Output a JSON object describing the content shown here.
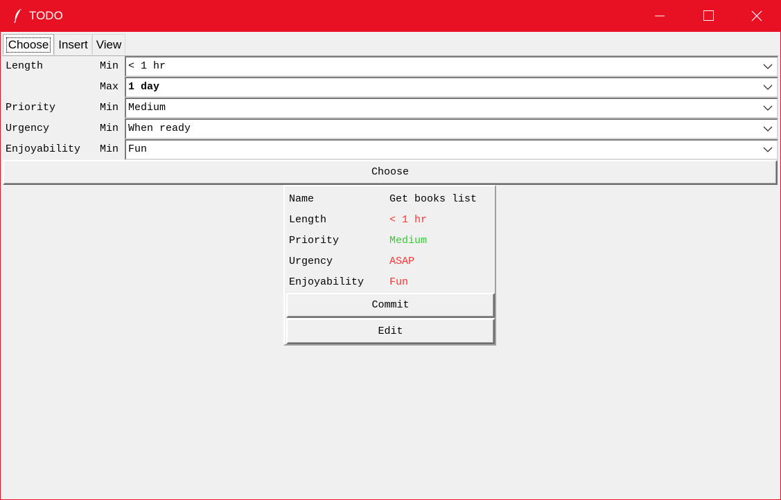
{
  "window": {
    "title": "TODO",
    "accent": "#e81123"
  },
  "tabs": [
    {
      "label": "Choose",
      "active": true
    },
    {
      "label": "Insert",
      "active": false
    },
    {
      "label": "View",
      "active": false
    }
  ],
  "filters": {
    "length": {
      "label": "Length",
      "min_label": "Min",
      "min_value": "< 1 hr",
      "max_label": "Max",
      "max_value": "1 day"
    },
    "priority": {
      "label": "Priority",
      "min_label": "Min",
      "min_value": "Medium"
    },
    "urgency": {
      "label": "Urgency",
      "min_label": "Min",
      "min_value": "When ready"
    },
    "enjoyability": {
      "label": "Enjoyability",
      "min_label": "Min",
      "min_value": "Fun"
    }
  },
  "choose_button": {
    "label": "Choose"
  },
  "result": {
    "rows": [
      {
        "key": "Name",
        "value": "Get books list",
        "color": "#000000"
      },
      {
        "key": "Length",
        "value": "< 1 hr",
        "color": "#ff3333"
      },
      {
        "key": "Priority",
        "value": "Medium",
        "color": "#33cc33"
      },
      {
        "key": "Urgency",
        "value": "ASAP",
        "color": "#ff3333"
      },
      {
        "key": "Enjoyability",
        "value": "Fun",
        "color": "#ff3333"
      }
    ],
    "commit_label": "Commit",
    "edit_label": "Edit"
  },
  "icons": {
    "app": "feather-icon",
    "minimize": "minimize-icon",
    "maximize": "maximize-icon",
    "close": "close-icon",
    "dropdown": "chevron-down-icon"
  }
}
